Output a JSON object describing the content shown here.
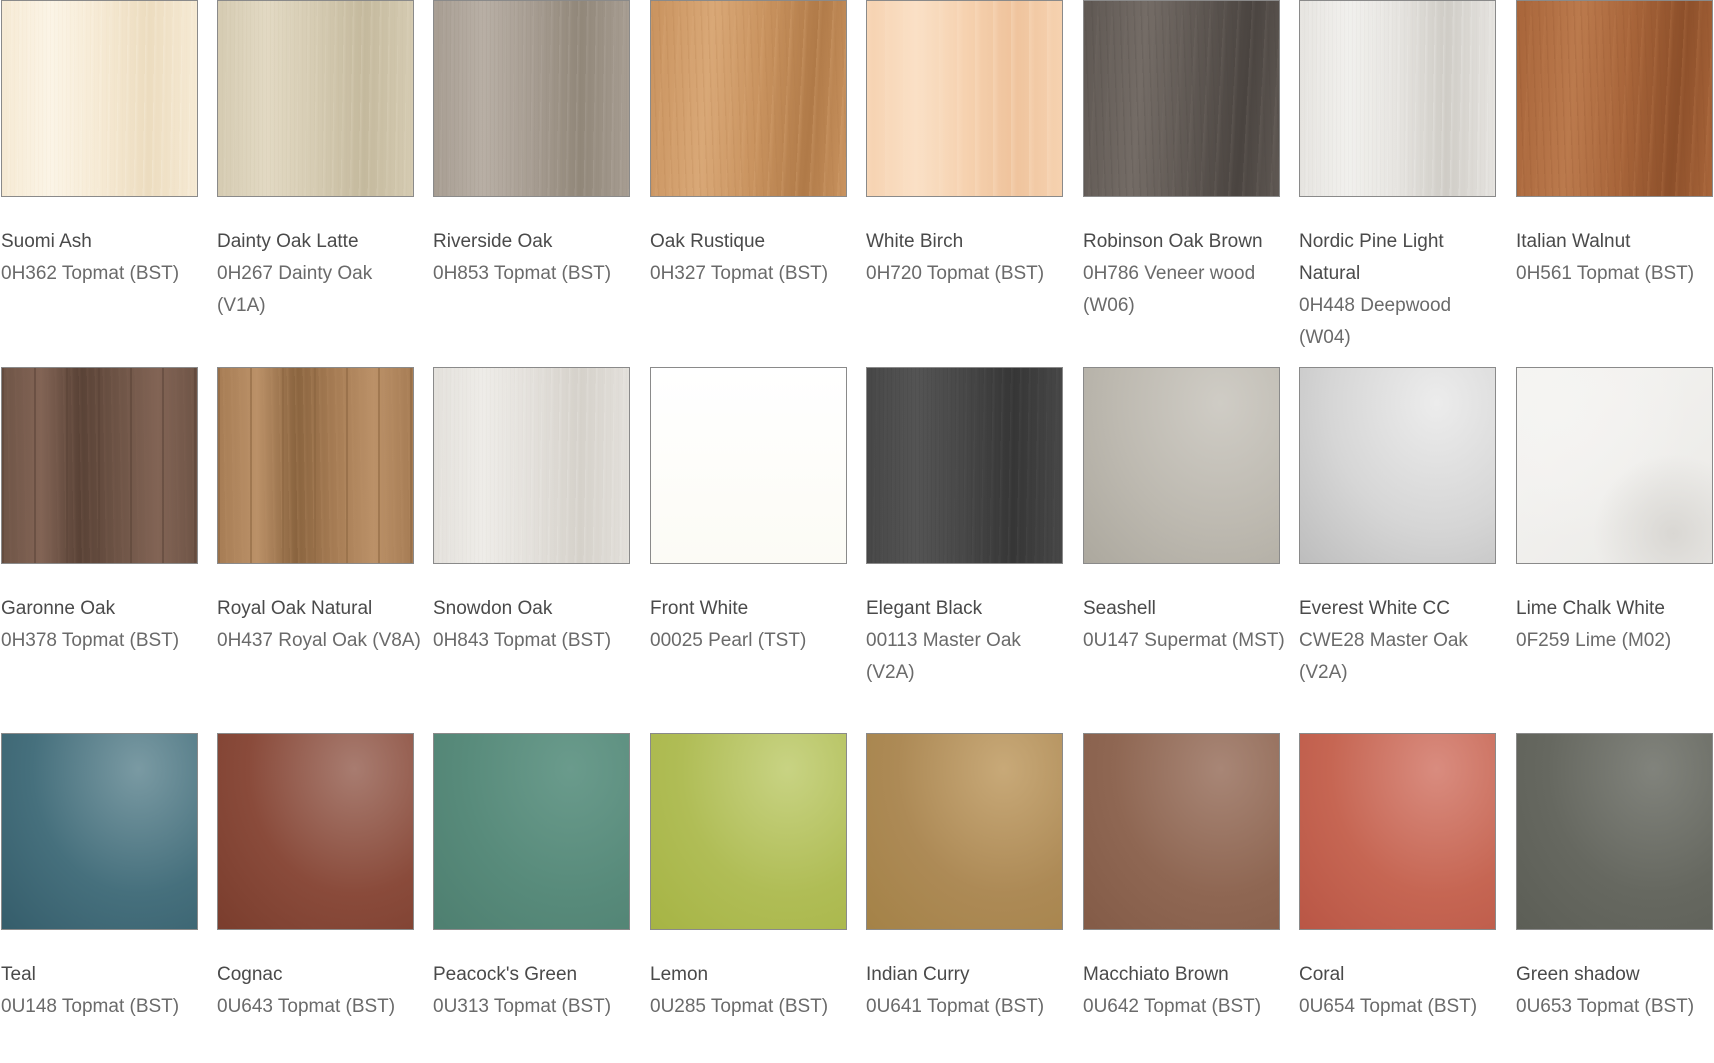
{
  "swatches": [
    {
      "name": "Suomi Ash",
      "code": "0H362 Topmat (BST)",
      "base": "#f6ead4",
      "light": "#fbf4e6",
      "dark": "#ecdcbf",
      "pattern": "wood-fine"
    },
    {
      "name": "Dainty Oak Latte",
      "code": "0H267 Dainty Oak (V1A)",
      "base": "#d5cbb2",
      "light": "#e2d9c3",
      "dark": "#c4b99d",
      "pattern": "wood-fine"
    },
    {
      "name": "Riverside  Oak",
      "code": "0H853 Topmat (BST)",
      "base": "#a79d92",
      "light": "#b8afa5",
      "dark": "#918779",
      "pattern": "wood-fine"
    },
    {
      "name": "Oak Rustique",
      "code": "0H327 Topmat (BST)",
      "base": "#c9935f",
      "light": "#d9a877",
      "dark": "#b07a48",
      "pattern": "wood-grain"
    },
    {
      "name": "White Birch",
      "code": "0H720 Topmat (BST)",
      "base": "#f6d2b0",
      "light": "#fae0c6",
      "dark": "#efc39c",
      "pattern": "wood-soft"
    },
    {
      "name": "Robinson Oak Brown",
      "code": "0H786 Veneer wood (W06)",
      "base": "#5f5853",
      "light": "#746c66",
      "dark": "#4a4440",
      "pattern": "wood-grain"
    },
    {
      "name": "Nordic Pine Light Natural",
      "code": "0H448 Deepwood (W04)",
      "base": "#e6e4e0",
      "light": "#f1f0ed",
      "dark": "#cfccc6",
      "pattern": "wood-fine"
    },
    {
      "name": "Italian Walnut",
      "code": "0H561 Topmat (BST)",
      "base": "#a8653a",
      "light": "#bb7a4d",
      "dark": "#8c4f2a",
      "pattern": "wood-grain"
    },
    {
      "name": "Garonne Oak",
      "code": "0H378 Topmat (BST)",
      "base": "#6e5446",
      "light": "#826455",
      "dark": "#594236",
      "pattern": "wood-plank"
    },
    {
      "name": "Royal Oak Natural",
      "code": "0H437 Royal Oak (V8A)",
      "base": "#a67c54",
      "light": "#bb9168",
      "dark": "#8a643f",
      "pattern": "wood-plank"
    },
    {
      "name": "Snowdon Oak",
      "code": "0H843 Topmat (BST)",
      "base": "#e3e0db",
      "light": "#eeece8",
      "dark": "#d5d1ca",
      "pattern": "wood-fine"
    },
    {
      "name": "Front White",
      "code": "00025 Pearl (TST)",
      "base": "#fcfbf5",
      "light": "#ffffff",
      "dark": "#f6f5ee",
      "pattern": "plain"
    },
    {
      "name": "Elegant Black",
      "code": "00113 Master Oak (V2A)",
      "base": "#474747",
      "light": "#545454",
      "dark": "#363636",
      "pattern": "wood-fine"
    },
    {
      "name": "Seashell",
      "code": "0U147 Supermat (MST)",
      "base": "#bdb9b0",
      "light": "#cfccc5",
      "dark": "#aca89e",
      "pattern": "gloss"
    },
    {
      "name": "Everest White CC",
      "code": "CWE28 Master Oak (V2A)",
      "base": "#d6d6d6",
      "light": "#ececec",
      "dark": "#bdbdbd",
      "pattern": "gloss"
    },
    {
      "name": "Lime Chalk White",
      "code": "0F259 Lime (M02)",
      "base": "#ebeae7",
      "light": "#f5f4f2",
      "dark": "#d9d7d3",
      "pattern": "speckle"
    },
    {
      "name": "Teal",
      "code": "0U148 Topmat (BST)",
      "base": "#46707d",
      "light": "#7a9aa3",
      "dark": "#355d6b",
      "pattern": "gloss"
    },
    {
      "name": "Cognac",
      "code": "0U643 Topmat (BST)",
      "base": "#8a4b3b",
      "light": "#a87c70",
      "dark": "#7a3d2d",
      "pattern": "gloss"
    },
    {
      "name": "Peacock's Green",
      "code": "0U313 Topmat (BST)",
      "base": "#588b7b",
      "light": "#6a9b8c",
      "dark": "#4e7f70",
      "pattern": "gloss"
    },
    {
      "name": "Lemon",
      "code": "0U285 Topmat (BST)",
      "base": "#b0bd56",
      "light": "#c8d383",
      "dark": "#a6b444",
      "pattern": "gloss"
    },
    {
      "name": "Indian Curry",
      "code": "0U641 Topmat (BST)",
      "base": "#ad8a56",
      "light": "#c8a978",
      "dark": "#a48247",
      "pattern": "gloss"
    },
    {
      "name": "Macchiato Brown",
      "code": "0U642 Topmat (BST)",
      "base": "#8f6753",
      "light": "#a88676",
      "dark": "#835b47",
      "pattern": "gloss"
    },
    {
      "name": "Coral",
      "code": "0U654 Topmat (BST)",
      "base": "#c66653",
      "light": "#d98c7f",
      "dark": "#b95645",
      "pattern": "gloss"
    },
    {
      "name": "Green shadow",
      "code": "0U653 Topmat (BST)",
      "base": "#666860",
      "light": "#81837c",
      "dark": "#5c5e56",
      "pattern": "gloss"
    }
  ]
}
